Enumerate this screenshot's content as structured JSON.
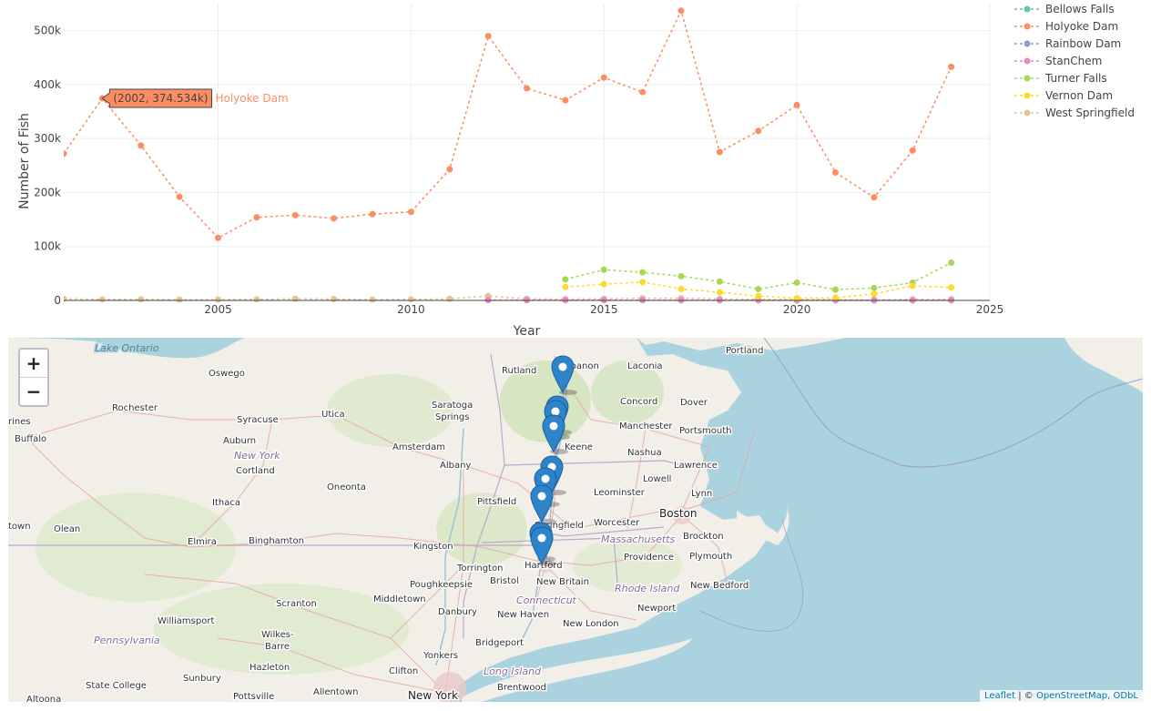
{
  "chart_data": {
    "type": "line",
    "xlabel": "Year",
    "ylabel": "Number of Fish",
    "xlim": [
      2001,
      2025
    ],
    "ylim": [
      0,
      550000
    ],
    "x_ticks": [
      2005,
      2010,
      2015,
      2020,
      2025
    ],
    "x_tick_labels": [
      "2005",
      "2010",
      "2015",
      "2020",
      "2025"
    ],
    "y_ticks": [
      0,
      100000,
      200000,
      300000,
      400000,
      500000
    ],
    "y_tick_labels": [
      "0",
      "100k",
      "200k",
      "300k",
      "400k",
      "500k"
    ],
    "grid": true,
    "legend_position": "top-right",
    "series": [
      {
        "name": "Bellows Falls",
        "color": "#66c2a5",
        "x": [],
        "y": []
      },
      {
        "name": "Holyoke Dam",
        "color": "#fc8d62",
        "x": [
          2001,
          2002,
          2003,
          2004,
          2005,
          2006,
          2007,
          2008,
          2009,
          2010,
          2011,
          2012,
          2013,
          2014,
          2015,
          2016,
          2017,
          2018,
          2019,
          2020,
          2021,
          2022,
          2023,
          2024
        ],
        "y": [
          272000,
          374534,
          287000,
          192000,
          116000,
          154000,
          158000,
          152000,
          160000,
          164000,
          243000,
          490000,
          393000,
          371000,
          413000,
          386000,
          537000,
          275000,
          314000,
          362000,
          237000,
          191000,
          278000,
          433000
        ]
      },
      {
        "name": "Rainbow Dam",
        "color": "#8da0cb",
        "x": [
          2012,
          2013,
          2014,
          2015,
          2016,
          2017,
          2018,
          2019,
          2020,
          2021,
          2022,
          2023,
          2024
        ],
        "y": [
          600,
          400,
          300,
          500,
          400,
          300,
          400,
          300,
          200,
          300,
          200,
          300,
          300
        ]
      },
      {
        "name": "StanChem",
        "color": "#e78ac3",
        "x": [
          2012,
          2013,
          2014,
          2015,
          2016,
          2017,
          2018,
          2019,
          2020,
          2021,
          2022,
          2023,
          2024
        ],
        "y": [
          800,
          500,
          700,
          600,
          500,
          700,
          400,
          500,
          300,
          400,
          300,
          500,
          400
        ]
      },
      {
        "name": "Turner Falls",
        "color": "#a6d854",
        "x": [
          2014,
          2015,
          2016,
          2017,
          2018,
          2019,
          2020,
          2021,
          2022,
          2023,
          2024
        ],
        "y": [
          39000,
          57000,
          52000,
          45000,
          35000,
          21000,
          33000,
          20000,
          23000,
          33000,
          70000
        ]
      },
      {
        "name": "Vernon Dam",
        "color": "#ffd92f",
        "x": [
          2014,
          2015,
          2016,
          2017,
          2018,
          2019,
          2020,
          2021,
          2022,
          2023,
          2024
        ],
        "y": [
          25000,
          30000,
          34000,
          21000,
          15000,
          8000,
          4000,
          5000,
          12000,
          27000,
          24000
        ]
      },
      {
        "name": "West Springfield",
        "color": "#e5c494",
        "x": [
          2001,
          2002,
          2003,
          2004,
          2005,
          2006,
          2007,
          2008,
          2009,
          2010,
          2011,
          2012,
          2013,
          2014,
          2015,
          2016,
          2017,
          2018,
          2019,
          2020,
          2021,
          2022,
          2023,
          2024
        ],
        "y": [
          3000,
          2000,
          2000,
          1500,
          1500,
          2000,
          3000,
          2500,
          1500,
          2000,
          3000,
          8000,
          3000,
          2500,
          3000,
          4000,
          4000,
          3000,
          2000,
          2000,
          1500,
          1000,
          2000,
          2500
        ]
      }
    ],
    "hover_tooltip": {
      "text": "(2002, 374.534k)",
      "series_label": "Holyoke Dam",
      "x": 2002,
      "y": 374534
    }
  },
  "map": {
    "zoom_in_label": "+",
    "zoom_out_label": "−",
    "attribution_leaflet": "Leaflet",
    "attribution_sep": " | © ",
    "attribution_osm": "OpenStreetMap, ODbL",
    "marker_count": 9,
    "labels": {
      "lake_ontario": "Lake Ontario",
      "portland": "Portland",
      "oswego": "Oswego",
      "rutland": "Rutland",
      "lebanon": "Lebanon",
      "laconia": "Laconia",
      "rochester": "Rochester",
      "saratoga": "Saratoga",
      "springs": "Springs",
      "concord": "Concord",
      "dover": "Dover",
      "rines": "rines",
      "syracuse": "Syracuse",
      "utica": "Utica",
      "manchester": "Manchester",
      "portsmouth": "Portsmouth",
      "buffalo": "Buffalo",
      "auburn": "Auburn",
      "amsterdam": "Amsterdam",
      "keene": "Keene",
      "nashua": "Nashua",
      "new_york_state": "New York",
      "cortland": "Cortland",
      "albany": "Albany",
      "lawrence": "Lawrence",
      "lowell": "Lowell",
      "oneonta": "Oneonta",
      "leominster": "Leominster",
      "lynn": "Lynn",
      "ithaca": "Ithaca",
      "pittsfield": "Pittsfield",
      "town": "town",
      "olean": "Olean",
      "springfield": "Springfield",
      "worcester": "Worcester",
      "boston": "Boston",
      "elmira": "Elmira",
      "binghamton": "Binghamton",
      "kingston": "Kingston",
      "massachusetts": "Massachusetts",
      "brockton": "Brockton",
      "providence": "Providence",
      "plymouth": "Plymouth",
      "torrington": "Torrington",
      "hartford": "Hartford",
      "poughkeepsie": "Poughkeepsie",
      "bristol": "Bristol",
      "new_britain": "New Britain",
      "rhode_island": "Rhode Island",
      "new_bedford": "New Bedford",
      "middletown": "Middletown",
      "connecticut": "Connecticut",
      "scranton": "Scranton",
      "newport": "Newport",
      "danbury": "Danbury",
      "new_haven": "New Haven",
      "williamsport": "Williamsport",
      "new_london": "New London",
      "wilkes": "Wilkes-",
      "barre": "Barre",
      "pennsylvania": "Pennsylvania",
      "bridgeport": "Bridgeport",
      "yonkers": "Yonkers",
      "hazleton": "Hazleton",
      "clifton": "Clifton",
      "long_island": "Long Island",
      "sunbury": "Sunbury",
      "state_college": "State College",
      "pottsville": "Pottsville",
      "allentown": "Allentown",
      "brentwood": "Brentwood",
      "new_york_city": "New York",
      "altoona": "Altoona"
    }
  }
}
